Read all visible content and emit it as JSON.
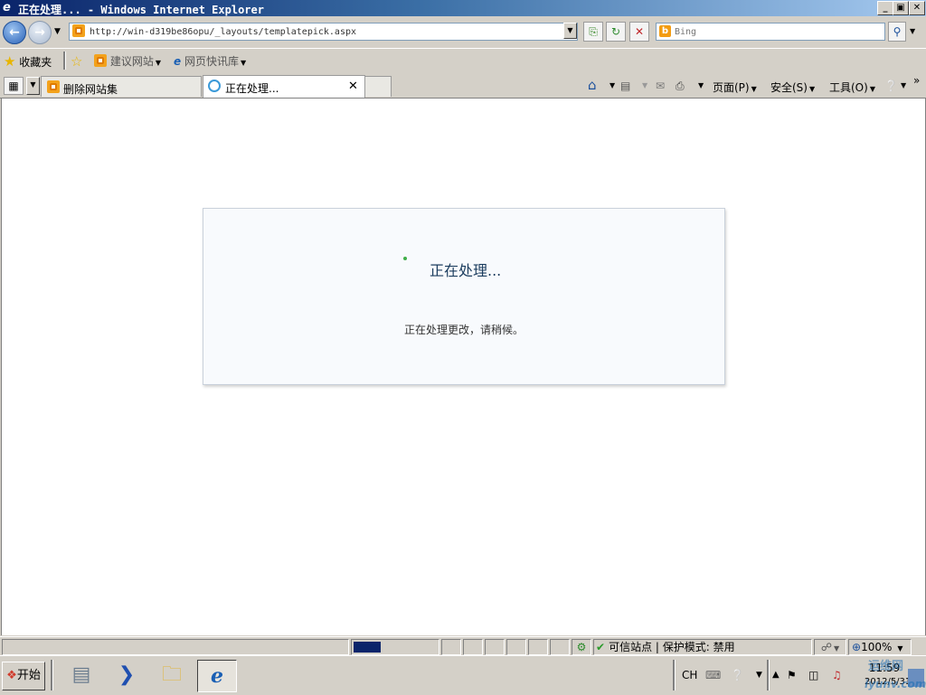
{
  "window": {
    "title": "正在处理... - Windows Internet Explorer"
  },
  "window_buttons": {
    "minimize": "_",
    "restore": "▣",
    "close": "✕"
  },
  "address_bar": {
    "url": "http://win-d319be86opu/_layouts/templatepick.aspx"
  },
  "search": {
    "placeholder": "Bing"
  },
  "favorites_bar": {
    "favorites_label": "收藏夹",
    "items": [
      {
        "label": "建议网站"
      },
      {
        "label": "网页快讯库"
      }
    ]
  },
  "tabs": [
    {
      "label": "删除网站集",
      "active": false
    },
    {
      "label": "正在处理...",
      "active": true
    }
  ],
  "command_bar": {
    "page": "页面(P)",
    "safety": "安全(S)",
    "tools": "工具(O)"
  },
  "dialog": {
    "heading": "正在处理...",
    "message": "正在处理更改，请稍候。"
  },
  "status_bar": {
    "progress_fraction": 0.33,
    "zone": "可信站点 | 保护模式: 禁用",
    "zoom": "100%"
  },
  "taskbar": {
    "start_label": "开始",
    "language": "CH",
    "clock_time": "11:59",
    "clock_date": "2012/5/31"
  },
  "watermark": {
    "text": "运维网",
    "url": "iyunv.com"
  },
  "colors": {
    "accent": "#0a246a",
    "dialog_heading": "#1b3c5e",
    "spinner": "#3fae49"
  }
}
